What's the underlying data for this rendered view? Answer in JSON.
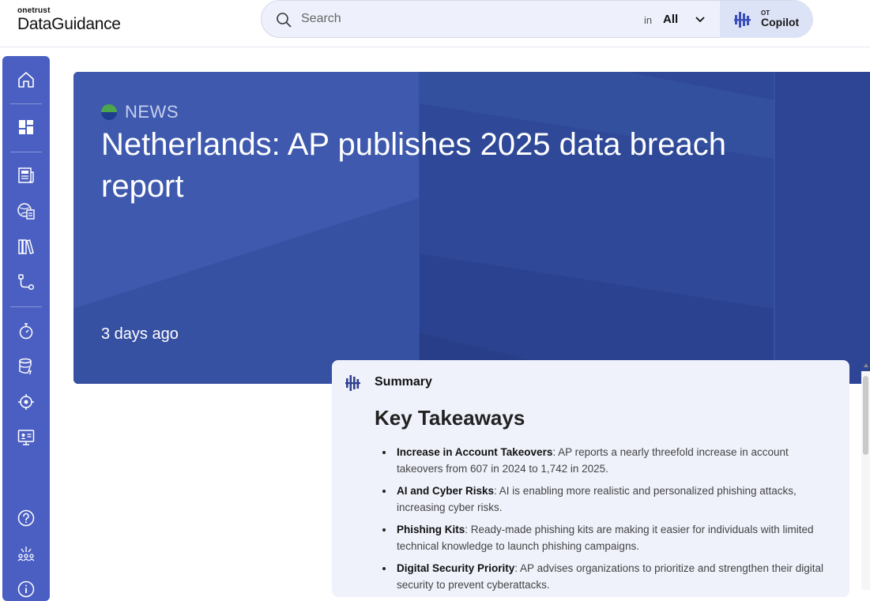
{
  "header": {
    "logo_small": "onetrust",
    "logo_big": "DataGuidance",
    "search_placeholder": "Search",
    "search_in": "in",
    "search_scope": "All",
    "copilot_small": "OT",
    "copilot_label": "Copilot"
  },
  "sidebar": {
    "items": [
      {
        "icon": "home-icon"
      },
      {
        "icon": "dashboard-icon"
      },
      {
        "icon": "news-icon"
      },
      {
        "icon": "globe-document-icon"
      },
      {
        "icon": "library-icon"
      },
      {
        "icon": "workflow-icon"
      },
      {
        "icon": "stopwatch-icon"
      },
      {
        "icon": "database-icon"
      },
      {
        "icon": "target-icon"
      },
      {
        "icon": "monitor-icon"
      },
      {
        "icon": "help-icon"
      },
      {
        "icon": "community-icon"
      },
      {
        "icon": "info-icon"
      }
    ]
  },
  "hero": {
    "tag": "NEWS",
    "title": "Netherlands: AP publishes 2025 data breach report",
    "date": "3 days ago"
  },
  "summary": {
    "label": "Summary",
    "heading": "Key Takeaways",
    "items": [
      {
        "term": "Increase in Account Takeovers",
        "text": ": AP reports a nearly threefold increase in account takeovers from 607 in 2024 to 1,742 in 2025."
      },
      {
        "term": "AI and Cyber Risks",
        "text": ": AI is enabling more realistic and personalized phishing attacks, increasing cyber risks."
      },
      {
        "term": "Phishing Kits",
        "text": ": Ready-made phishing kits are making it easier for individuals with limited technical knowledge to launch phishing campaigns."
      },
      {
        "term": "Digital Security Priority",
        "text": ": AP advises organizations to prioritize and strengthen their digital security to prevent cyberattacks."
      }
    ]
  },
  "colors": {
    "sidebar": "#4a5fc1",
    "hero": "#3953a7",
    "summary_bg": "#eff2fb"
  }
}
